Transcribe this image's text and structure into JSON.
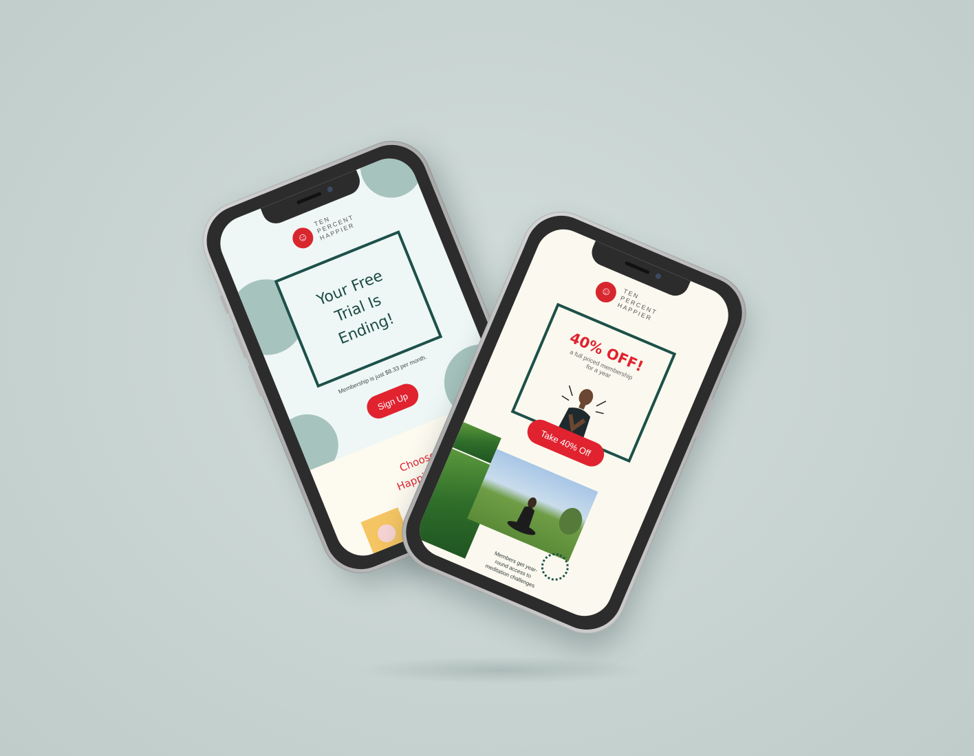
{
  "brand": {
    "line1": "TEN",
    "line2": "PERCENT",
    "line3": "HAPPIER",
    "logo_icon": "smile-icon"
  },
  "phone1": {
    "headline_line1": "Your Free",
    "headline_line2": "Trial Is",
    "headline_line3": "Ending!",
    "membership_text": "Membership is just $8.33 per month.",
    "signup_label": "Sign Up",
    "choose_line1": "Choose",
    "choose_line2": "Happiness.",
    "icons": [
      "sticker-icon",
      "peace-icon",
      "heart-icon"
    ]
  },
  "phone2": {
    "offer_title": "40% OFF!",
    "offer_sub_line1": "a full priced membership",
    "offer_sub_line2": "for a year",
    "cta_label": "Take 40% Off",
    "caption_line1": "Members get year-",
    "caption_line2": "round access to",
    "caption_line3": "meditation challenges"
  },
  "colors": {
    "accent_red": "#e0232f",
    "dark_green": "#1d5049",
    "mint_bg": "#eef7f6",
    "cream_bg": "#fdfaf0",
    "blob": "#a7c3bd"
  }
}
